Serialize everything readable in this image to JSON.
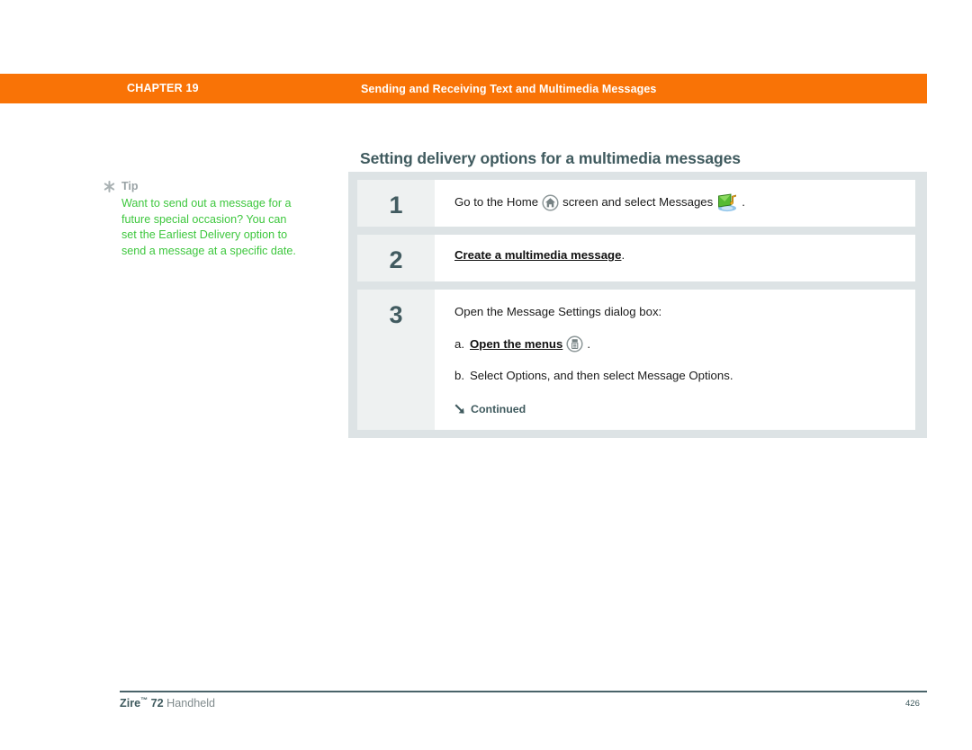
{
  "header": {
    "chapter_label": "CHAPTER 19",
    "running_head": "Sending and Receiving Text and Multimedia Messages",
    "bar_color": "#f97306"
  },
  "page_title": "Setting delivery options for a multimedia messages",
  "tip": {
    "icon": "asterisk-icon",
    "title": "Tip",
    "body": "Want to send out a message for a future special occasion? You can set the Earliest Delivery option to send a message at a specific date.",
    "text_color": "#3ec73e",
    "title_color": "#9aa3a6"
  },
  "steps": [
    {
      "number": "1",
      "text_before_home": "Go to the Home",
      "home_icon": "home-icon",
      "text_middle": "screen and select Messages",
      "messages_icon": "messages-app-icon",
      "text_after": "."
    },
    {
      "number": "2",
      "link_text": "Create a multimedia message",
      "text_after": "."
    },
    {
      "number": "3",
      "intro": "Open the Message Settings dialog box:",
      "substeps": [
        {
          "marker": "a.",
          "link_text": "Open the menus",
          "icon": "menu-icon",
          "text_after": "."
        },
        {
          "marker": "b.",
          "text": "Select Options, and then select Message Options."
        }
      ],
      "continued_label": "Continued",
      "continued_icon": "arrow-down-right-icon"
    }
  ],
  "footer": {
    "product_bold": "Zire",
    "trademark": "™",
    "product_model": "72",
    "product_suffix": "Handheld",
    "page_number": "426"
  }
}
